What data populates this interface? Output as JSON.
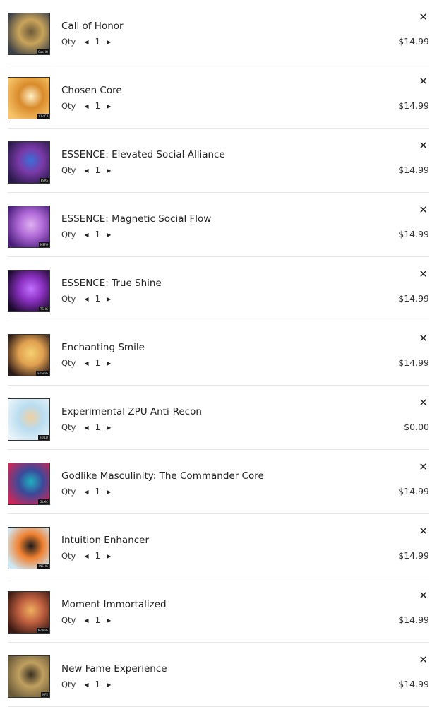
{
  "cart": {
    "qty_label": "Qty",
    "close_glyph": "✕",
    "decrease_glyph": "◀",
    "increase_glyph": "▶",
    "items": [
      {
        "title": "Call of Honor",
        "qty": "1",
        "price": "$14.99",
        "tag": "CaoHO",
        "colors": [
          "#3b4048",
          "#c9a45a",
          "#6e5a3a"
        ]
      },
      {
        "title": "Chosen Core",
        "qty": "1",
        "price": "$14.99",
        "tag": "ChoCP",
        "colors": [
          "#f7c46a",
          "#d98b2b",
          "#fff0c8"
        ]
      },
      {
        "title": "ESSENCE: Elevated Social Alliance",
        "qty": "1",
        "price": "$14.99",
        "tag": "ESAS",
        "colors": [
          "#2a1a4a",
          "#7a3aa8",
          "#3a6fd8"
        ]
      },
      {
        "title": "ESSENCE: Magnetic Social Flow",
        "qty": "1",
        "price": "$14.99",
        "tag": "MSFG",
        "colors": [
          "#4a1f7a",
          "#b06ad8",
          "#e0b0f0"
        ]
      },
      {
        "title": "ESSENCE: True Shine",
        "qty": "1",
        "price": "$14.99",
        "tag": "TSHG",
        "colors": [
          "#1a0a2a",
          "#8a30c0",
          "#c070ff"
        ]
      },
      {
        "title": "Enchanting Smile",
        "qty": "1",
        "price": "$14.99",
        "tag": "EnSmG",
        "colors": [
          "#2a1a18",
          "#e0a050",
          "#f5d070"
        ]
      },
      {
        "title": "Experimental ZPU Anti-Recon",
        "qty": "1",
        "price": "$0.00",
        "tag": "BUILD",
        "colors": [
          "#e8f4fa",
          "#b9dcef",
          "#f0d0a0"
        ]
      },
      {
        "title": "Godlike Masculinity: The Commander Core",
        "qty": "1",
        "price": "$14.99",
        "tag": "GLMC",
        "colors": [
          "#c8285a",
          "#3a4a9a",
          "#20b0c0"
        ]
      },
      {
        "title": "Intuition Enhancer",
        "qty": "1",
        "price": "$14.99",
        "tag": "INEHG",
        "colors": [
          "#cfe8f5",
          "#f08030",
          "#1a1a1a"
        ]
      },
      {
        "title": "Moment Immortalized",
        "qty": "1",
        "price": "$14.99",
        "tag": "MoImG",
        "colors": [
          "#3a1a14",
          "#c06040",
          "#f0b060"
        ]
      },
      {
        "title": "New Fame Experience",
        "qty": "1",
        "price": "$14.99",
        "tag": "NFE",
        "colors": [
          "#6a5a3a",
          "#c0a060",
          "#3a3020"
        ]
      }
    ]
  }
}
